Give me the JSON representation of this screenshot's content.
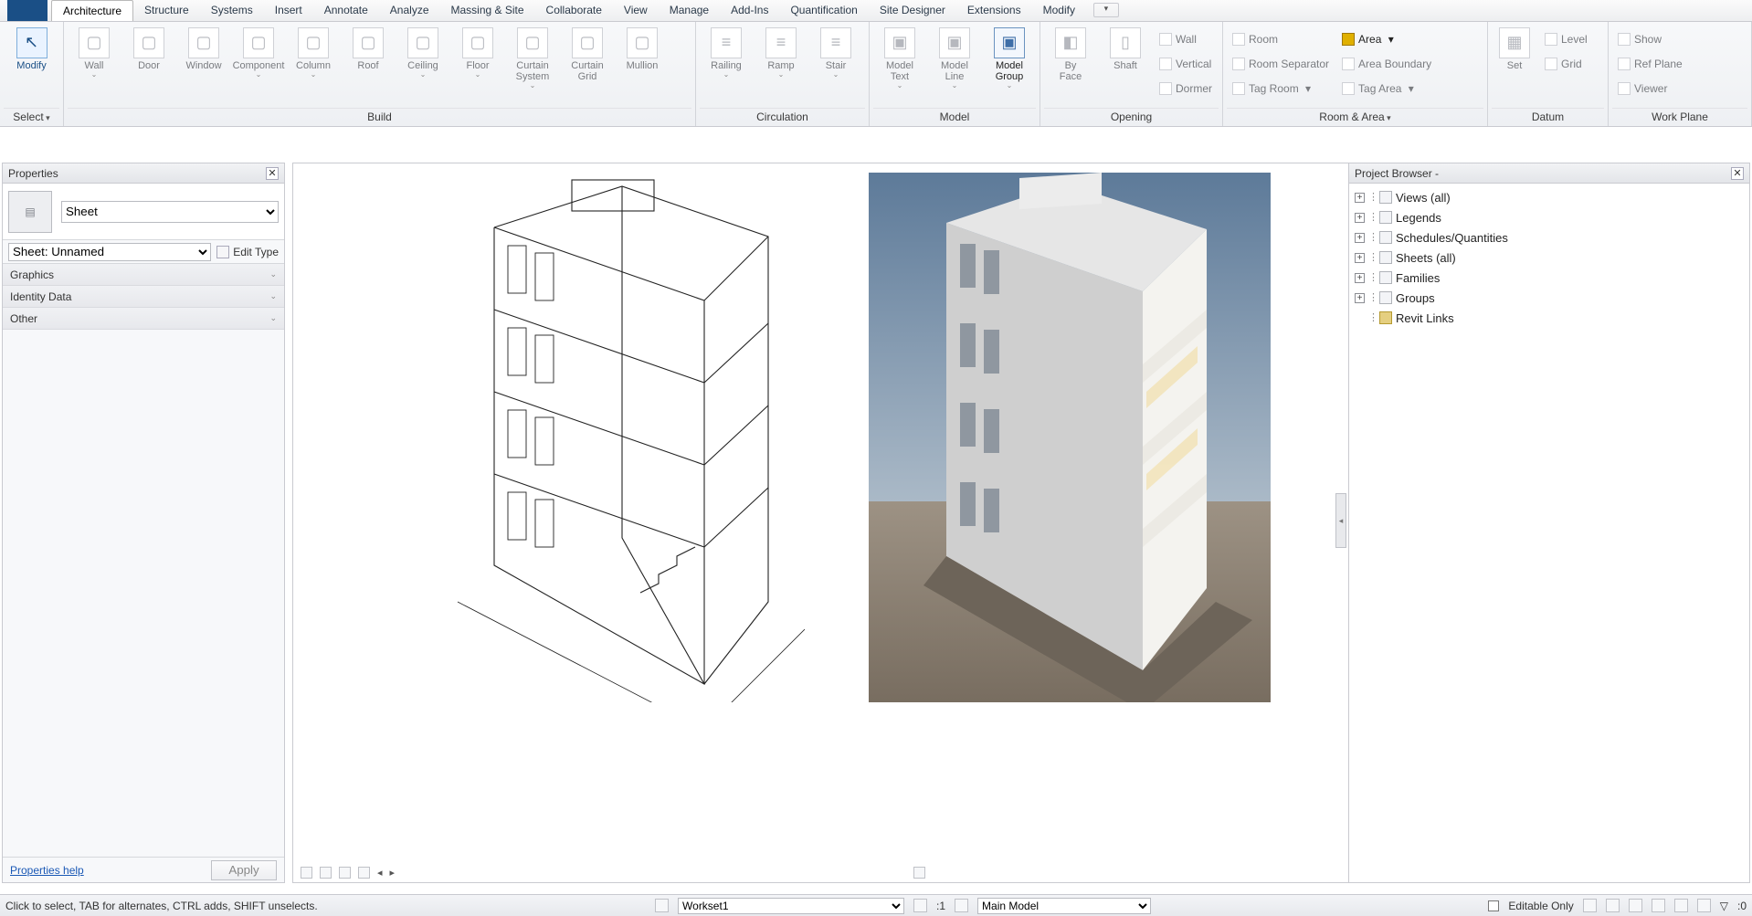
{
  "tabs": [
    "Architecture",
    "Structure",
    "Systems",
    "Insert",
    "Annotate",
    "Analyze",
    "Massing & Site",
    "Collaborate",
    "View",
    "Manage",
    "Add-Ins",
    "Quantification",
    "Site Designer",
    "Extensions",
    "Modify"
  ],
  "active_tab_index": 0,
  "ribbon": {
    "select": {
      "modify": "Modify",
      "label": "Select"
    },
    "build": {
      "items": [
        "Wall",
        "Door",
        "Window",
        "Component",
        "Column",
        "Roof",
        "Ceiling",
        "Floor",
        "Curtain\nSystem",
        "Curtain\nGrid",
        "Mullion"
      ],
      "label": "Build"
    },
    "circ": {
      "items": [
        "Railing",
        "Ramp",
        "Stair"
      ],
      "label": "Circulation"
    },
    "model": {
      "items": [
        "Model\nText",
        "Model\nLine",
        "Model\nGroup"
      ],
      "label": "Model"
    },
    "opening": {
      "big": [
        "By\nFace",
        "Shaft"
      ],
      "rows": [
        "Wall",
        "Vertical",
        "Dormer"
      ],
      "label": "Opening"
    },
    "roomarea": {
      "left": [
        "Room",
        "Room  Separator",
        "Tag  Room"
      ],
      "right": [
        "Area",
        "Area  Boundary",
        "Tag  Area"
      ],
      "label": "Room & Area"
    },
    "datum": {
      "big": "Set",
      "rows": [
        "Level",
        "Grid"
      ],
      "label": "Datum"
    },
    "wplane": {
      "rows": [
        "Show",
        "Ref  Plane",
        "Viewer"
      ],
      "label": "Work Plane"
    }
  },
  "properties": {
    "title": "Properties",
    "type_selector": "Sheet",
    "instance_selector": "Sheet: Unnamed",
    "edit_type": "Edit Type",
    "categories": [
      "Graphics",
      "Identity Data",
      "Other"
    ],
    "help": "Properties help",
    "apply": "Apply"
  },
  "browser": {
    "title": "Project Browser -",
    "nodes": [
      {
        "pm": "+",
        "dots": true,
        "icon": "std",
        "label": "Views (all)"
      },
      {
        "pm": "+",
        "dots": true,
        "icon": "std",
        "label": "Legends"
      },
      {
        "pm": "+",
        "dots": true,
        "icon": "std",
        "label": "Schedules/Quantities"
      },
      {
        "pm": "+",
        "dots": true,
        "icon": "std",
        "label": "Sheets (all)"
      },
      {
        "pm": "+",
        "dots": true,
        "icon": "std",
        "label": "Families"
      },
      {
        "pm": "+",
        "dots": true,
        "icon": "std",
        "label": "Groups"
      },
      {
        "pm": " ",
        "dots": true,
        "icon": "link",
        "label": "Revit Links"
      }
    ]
  },
  "status": {
    "hint": "Click to select, TAB for alternates, CTRL adds, SHIFT unselects.",
    "workset": "Workset1",
    "active_only": ":1",
    "design_option": "Main Model",
    "editable": "Editable Only",
    "filter_count": ":0"
  },
  "viewport_icons": [
    "⌂",
    "▣",
    "✕",
    "^"
  ]
}
